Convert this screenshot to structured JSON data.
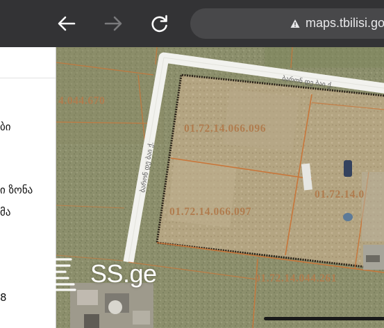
{
  "browser": {
    "url": "maps.tbilisi.gov.ge",
    "back_icon": "back-arrow-icon",
    "forward_icon": "forward-arrow-icon",
    "reload_icon": "reload-icon",
    "security_icon": "warning-triangle-icon"
  },
  "panel": {
    "lines": [
      "ბი",
      "ი ზონა",
      "მა",
      "8"
    ]
  },
  "map": {
    "parcels": [
      "4.044.670",
      "01.72.14.066.096",
      "01.72.14.066.097",
      "01.72.14.0",
      "01.72.14.044.261"
    ],
    "streets": [
      "ბარონ დე ბაი ქ.",
      "ბარონ დე ბაი ქ."
    ]
  },
  "watermark": {
    "text": "SS.ge"
  },
  "colors": {
    "parcel_line": "#c8763a",
    "road": "#f2f2ee",
    "toolbar": "#333335"
  }
}
